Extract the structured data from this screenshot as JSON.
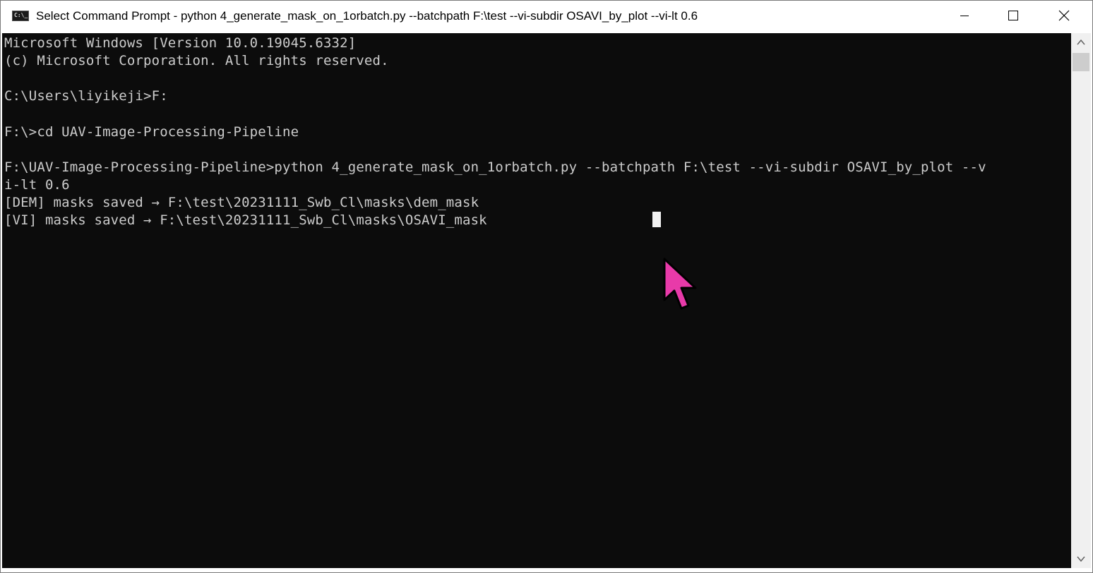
{
  "window": {
    "title": "Select Command Prompt - python  4_generate_mask_on_1orbatch.py --batchpath F:\\test --vi-subdir OSAVI_by_plot --vi-lt 0.6",
    "icon": "console-icon",
    "controls": {
      "minimize": "minimize-icon",
      "maximize": "maximize-icon",
      "close": "close-icon"
    }
  },
  "console": {
    "background_color": "#0c0c0c",
    "text_color": "#cccccc",
    "lines": [
      "Microsoft Windows [Version 10.0.19045.6332]",
      "(c) Microsoft Corporation. All rights reserved.",
      "",
      "C:\\Users\\liyikeji>F:",
      "",
      "F:\\>cd UAV-Image-Processing-Pipeline",
      "",
      "F:\\UAV-Image-Processing-Pipeline>python 4_generate_mask_on_1orbatch.py --batchpath F:\\test --vi-subdir OSAVI_by_plot --v",
      "i-lt 0.6",
      "[DEM] masks saved → F:\\test\\20231111_Swb_Cl\\masks\\dem_mask",
      "[VI] masks saved → F:\\test\\20231111_Swb_Cl\\masks\\OSAVI_mask"
    ]
  },
  "pointer": {
    "icon": "mouse-pointer-icon",
    "color": "#e83aa9"
  },
  "scrollbar": {
    "up": "chevron-up-icon",
    "down": "chevron-down-icon"
  }
}
